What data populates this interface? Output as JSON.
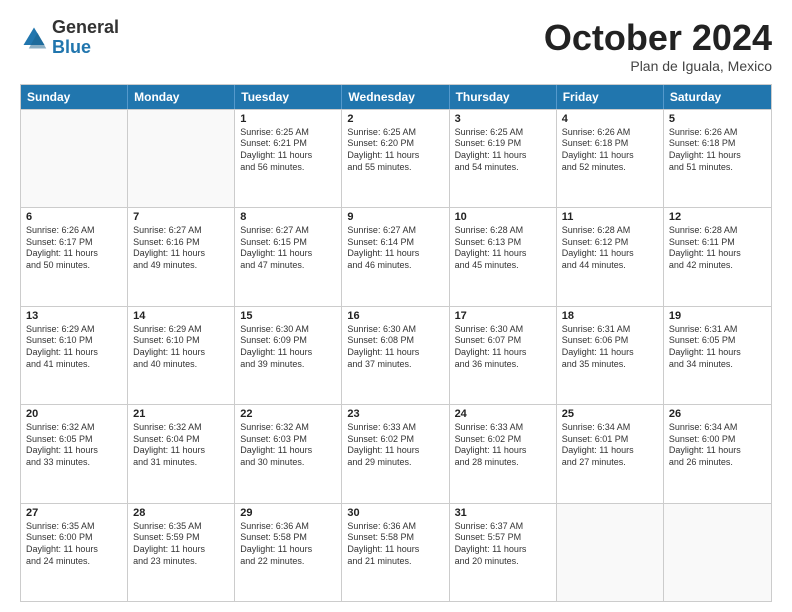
{
  "logo": {
    "general": "General",
    "blue": "Blue"
  },
  "title": "October 2024",
  "subtitle": "Plan de Iguala, Mexico",
  "headers": [
    "Sunday",
    "Monday",
    "Tuesday",
    "Wednesday",
    "Thursday",
    "Friday",
    "Saturday"
  ],
  "weeks": [
    [
      {
        "day": "",
        "lines": []
      },
      {
        "day": "",
        "lines": []
      },
      {
        "day": "1",
        "lines": [
          "Sunrise: 6:25 AM",
          "Sunset: 6:21 PM",
          "Daylight: 11 hours",
          "and 56 minutes."
        ]
      },
      {
        "day": "2",
        "lines": [
          "Sunrise: 6:25 AM",
          "Sunset: 6:20 PM",
          "Daylight: 11 hours",
          "and 55 minutes."
        ]
      },
      {
        "day": "3",
        "lines": [
          "Sunrise: 6:25 AM",
          "Sunset: 6:19 PM",
          "Daylight: 11 hours",
          "and 54 minutes."
        ]
      },
      {
        "day": "4",
        "lines": [
          "Sunrise: 6:26 AM",
          "Sunset: 6:18 PM",
          "Daylight: 11 hours",
          "and 52 minutes."
        ]
      },
      {
        "day": "5",
        "lines": [
          "Sunrise: 6:26 AM",
          "Sunset: 6:18 PM",
          "Daylight: 11 hours",
          "and 51 minutes."
        ]
      }
    ],
    [
      {
        "day": "6",
        "lines": [
          "Sunrise: 6:26 AM",
          "Sunset: 6:17 PM",
          "Daylight: 11 hours",
          "and 50 minutes."
        ]
      },
      {
        "day": "7",
        "lines": [
          "Sunrise: 6:27 AM",
          "Sunset: 6:16 PM",
          "Daylight: 11 hours",
          "and 49 minutes."
        ]
      },
      {
        "day": "8",
        "lines": [
          "Sunrise: 6:27 AM",
          "Sunset: 6:15 PM",
          "Daylight: 11 hours",
          "and 47 minutes."
        ]
      },
      {
        "day": "9",
        "lines": [
          "Sunrise: 6:27 AM",
          "Sunset: 6:14 PM",
          "Daylight: 11 hours",
          "and 46 minutes."
        ]
      },
      {
        "day": "10",
        "lines": [
          "Sunrise: 6:28 AM",
          "Sunset: 6:13 PM",
          "Daylight: 11 hours",
          "and 45 minutes."
        ]
      },
      {
        "day": "11",
        "lines": [
          "Sunrise: 6:28 AM",
          "Sunset: 6:12 PM",
          "Daylight: 11 hours",
          "and 44 minutes."
        ]
      },
      {
        "day": "12",
        "lines": [
          "Sunrise: 6:28 AM",
          "Sunset: 6:11 PM",
          "Daylight: 11 hours",
          "and 42 minutes."
        ]
      }
    ],
    [
      {
        "day": "13",
        "lines": [
          "Sunrise: 6:29 AM",
          "Sunset: 6:10 PM",
          "Daylight: 11 hours",
          "and 41 minutes."
        ]
      },
      {
        "day": "14",
        "lines": [
          "Sunrise: 6:29 AM",
          "Sunset: 6:10 PM",
          "Daylight: 11 hours",
          "and 40 minutes."
        ]
      },
      {
        "day": "15",
        "lines": [
          "Sunrise: 6:30 AM",
          "Sunset: 6:09 PM",
          "Daylight: 11 hours",
          "and 39 minutes."
        ]
      },
      {
        "day": "16",
        "lines": [
          "Sunrise: 6:30 AM",
          "Sunset: 6:08 PM",
          "Daylight: 11 hours",
          "and 37 minutes."
        ]
      },
      {
        "day": "17",
        "lines": [
          "Sunrise: 6:30 AM",
          "Sunset: 6:07 PM",
          "Daylight: 11 hours",
          "and 36 minutes."
        ]
      },
      {
        "day": "18",
        "lines": [
          "Sunrise: 6:31 AM",
          "Sunset: 6:06 PM",
          "Daylight: 11 hours",
          "and 35 minutes."
        ]
      },
      {
        "day": "19",
        "lines": [
          "Sunrise: 6:31 AM",
          "Sunset: 6:05 PM",
          "Daylight: 11 hours",
          "and 34 minutes."
        ]
      }
    ],
    [
      {
        "day": "20",
        "lines": [
          "Sunrise: 6:32 AM",
          "Sunset: 6:05 PM",
          "Daylight: 11 hours",
          "and 33 minutes."
        ]
      },
      {
        "day": "21",
        "lines": [
          "Sunrise: 6:32 AM",
          "Sunset: 6:04 PM",
          "Daylight: 11 hours",
          "and 31 minutes."
        ]
      },
      {
        "day": "22",
        "lines": [
          "Sunrise: 6:32 AM",
          "Sunset: 6:03 PM",
          "Daylight: 11 hours",
          "and 30 minutes."
        ]
      },
      {
        "day": "23",
        "lines": [
          "Sunrise: 6:33 AM",
          "Sunset: 6:02 PM",
          "Daylight: 11 hours",
          "and 29 minutes."
        ]
      },
      {
        "day": "24",
        "lines": [
          "Sunrise: 6:33 AM",
          "Sunset: 6:02 PM",
          "Daylight: 11 hours",
          "and 28 minutes."
        ]
      },
      {
        "day": "25",
        "lines": [
          "Sunrise: 6:34 AM",
          "Sunset: 6:01 PM",
          "Daylight: 11 hours",
          "and 27 minutes."
        ]
      },
      {
        "day": "26",
        "lines": [
          "Sunrise: 6:34 AM",
          "Sunset: 6:00 PM",
          "Daylight: 11 hours",
          "and 26 minutes."
        ]
      }
    ],
    [
      {
        "day": "27",
        "lines": [
          "Sunrise: 6:35 AM",
          "Sunset: 6:00 PM",
          "Daylight: 11 hours",
          "and 24 minutes."
        ]
      },
      {
        "day": "28",
        "lines": [
          "Sunrise: 6:35 AM",
          "Sunset: 5:59 PM",
          "Daylight: 11 hours",
          "and 23 minutes."
        ]
      },
      {
        "day": "29",
        "lines": [
          "Sunrise: 6:36 AM",
          "Sunset: 5:58 PM",
          "Daylight: 11 hours",
          "and 22 minutes."
        ]
      },
      {
        "day": "30",
        "lines": [
          "Sunrise: 6:36 AM",
          "Sunset: 5:58 PM",
          "Daylight: 11 hours",
          "and 21 minutes."
        ]
      },
      {
        "day": "31",
        "lines": [
          "Sunrise: 6:37 AM",
          "Sunset: 5:57 PM",
          "Daylight: 11 hours",
          "and 20 minutes."
        ]
      },
      {
        "day": "",
        "lines": []
      },
      {
        "day": "",
        "lines": []
      }
    ]
  ]
}
